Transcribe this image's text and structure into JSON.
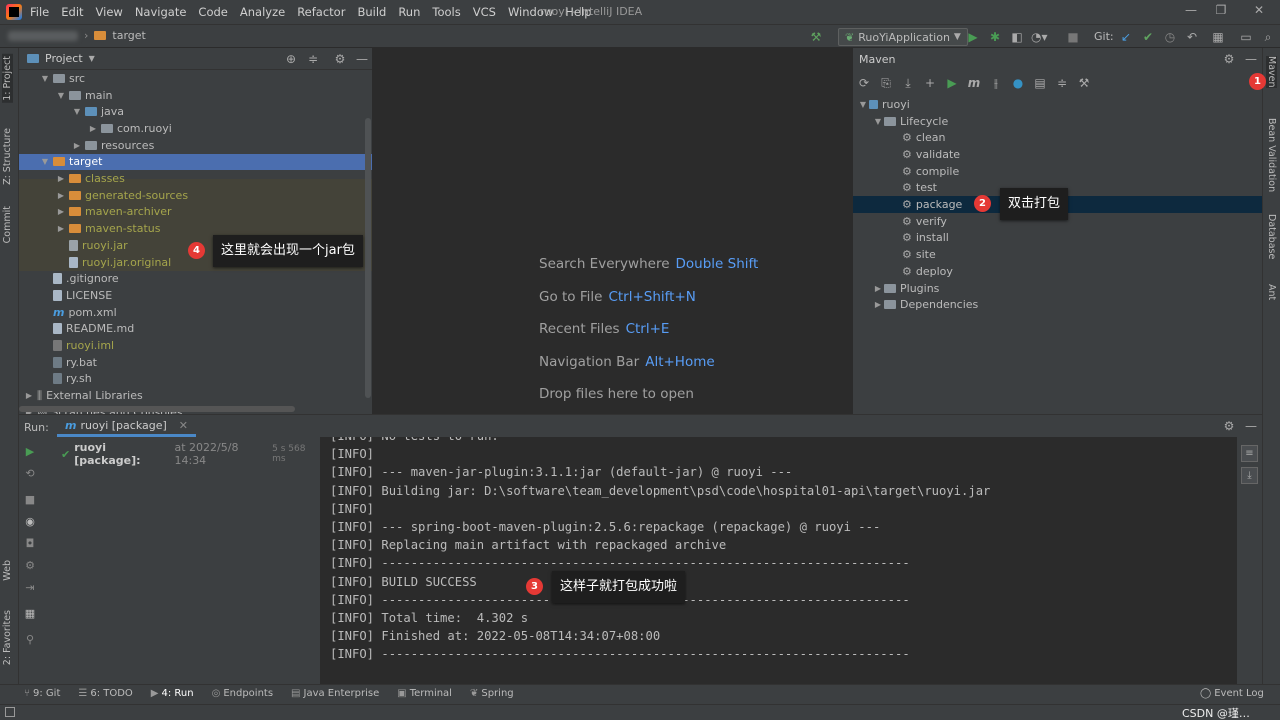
{
  "menubar": {
    "items": [
      "File",
      "Edit",
      "View",
      "Navigate",
      "Code",
      "Analyze",
      "Refactor",
      "Build",
      "Run",
      "Tools",
      "VCS",
      "Window",
      "Help"
    ],
    "window_title": "ruoyi - IntelliJ IDEA"
  },
  "navbar": {
    "breadcrumb": "target",
    "run_config": "RuoYiApplication",
    "git_label": "Git:"
  },
  "left_stripe": {
    "tabs": [
      "1: Project",
      "Z: Structure",
      "Commit",
      "Web",
      "2: Favorites"
    ]
  },
  "right_stripe": {
    "tabs": [
      "Maven",
      "Bean Validation",
      "Database",
      "Ant"
    ]
  },
  "project": {
    "title": "Project",
    "tree": [
      {
        "label": "src",
        "indent": 1,
        "arrow": "▼",
        "icon": "folder"
      },
      {
        "label": "main",
        "indent": 2,
        "arrow": "▼",
        "icon": "folder"
      },
      {
        "label": "java",
        "indent": 3,
        "arrow": "▼",
        "icon": "folder-blue"
      },
      {
        "label": "com.ruoyi",
        "indent": 4,
        "arrow": "▶",
        "icon": "package"
      },
      {
        "label": "resources",
        "indent": 3,
        "arrow": "▶",
        "icon": "folder-res"
      },
      {
        "label": "target",
        "indent": 1,
        "arrow": "▼",
        "icon": "folder-orange",
        "selected": true
      },
      {
        "label": "classes",
        "indent": 2,
        "arrow": "▶",
        "icon": "folder-orange",
        "olive": true
      },
      {
        "label": "generated-sources",
        "indent": 2,
        "arrow": "▶",
        "icon": "folder-orange",
        "olive": true
      },
      {
        "label": "maven-archiver",
        "indent": 2,
        "arrow": "▶",
        "icon": "folder-orange",
        "olive": true
      },
      {
        "label": "maven-status",
        "indent": 2,
        "arrow": "▶",
        "icon": "folder-orange",
        "olive": true
      },
      {
        "label": "ruoyi.jar",
        "indent": 2,
        "arrow": "",
        "icon": "jar",
        "olive": true
      },
      {
        "label": "ruoyi.jar.original",
        "indent": 2,
        "arrow": "",
        "icon": "file",
        "olive": true
      },
      {
        "label": ".gitignore",
        "indent": 1,
        "arrow": "",
        "icon": "file"
      },
      {
        "label": "LICENSE",
        "indent": 1,
        "arrow": "",
        "icon": "file"
      },
      {
        "label": "pom.xml",
        "indent": 1,
        "arrow": "",
        "icon": "maven"
      },
      {
        "label": "README.md",
        "indent": 1,
        "arrow": "",
        "icon": "file"
      },
      {
        "label": "ruoyi.iml",
        "indent": 1,
        "arrow": "",
        "icon": "iml",
        "olive": true
      },
      {
        "label": "ry.bat",
        "indent": 1,
        "arrow": "",
        "icon": "bat"
      },
      {
        "label": "ry.sh",
        "indent": 1,
        "arrow": "",
        "icon": "bat"
      },
      {
        "label": "External Libraries",
        "indent": 0,
        "arrow": "▶",
        "icon": "libs"
      },
      {
        "label": "Scratches and Consoles",
        "indent": 0,
        "arrow": "▶",
        "icon": "scratch"
      }
    ]
  },
  "editor": {
    "hints": [
      {
        "text": "Search Everywhere",
        "key": "Double Shift"
      },
      {
        "text": "Go to File",
        "key": "Ctrl+Shift+N"
      },
      {
        "text": "Recent Files",
        "key": "Ctrl+E"
      },
      {
        "text": "Navigation Bar",
        "key": "Alt+Home"
      },
      {
        "text": "Drop files here to open",
        "key": ""
      }
    ]
  },
  "maven": {
    "title": "Maven",
    "tree": [
      {
        "label": "ruoyi",
        "indent": 0,
        "arrow": "▼",
        "icon": "maven-root"
      },
      {
        "label": "Lifecycle",
        "indent": 1,
        "arrow": "▼",
        "icon": "folder-gear"
      },
      {
        "label": "clean",
        "indent": 3,
        "icon": "gear"
      },
      {
        "label": "validate",
        "indent": 3,
        "icon": "gear"
      },
      {
        "label": "compile",
        "indent": 3,
        "icon": "gear"
      },
      {
        "label": "test",
        "indent": 3,
        "icon": "gear"
      },
      {
        "label": "package",
        "indent": 3,
        "icon": "gear",
        "selected": true
      },
      {
        "label": "verify",
        "indent": 3,
        "icon": "gear"
      },
      {
        "label": "install",
        "indent": 3,
        "icon": "gear"
      },
      {
        "label": "site",
        "indent": 3,
        "icon": "gear"
      },
      {
        "label": "deploy",
        "indent": 3,
        "icon": "gear"
      },
      {
        "label": "Plugins",
        "indent": 1,
        "arrow": "▶",
        "icon": "folder-gear"
      },
      {
        "label": "Dependencies",
        "indent": 1,
        "arrow": "▶",
        "icon": "folder-gear"
      }
    ]
  },
  "callouts": {
    "c1": {
      "num": "1"
    },
    "c2": {
      "num": "2",
      "text": "双击打包"
    },
    "c3": {
      "num": "3",
      "text": "这样子就打包成功啦"
    },
    "c4": {
      "num": "4",
      "text": "这里就会出现一个jar包"
    }
  },
  "run": {
    "label": "Run:",
    "tab": "ruoyi [package]",
    "tree_item": "ruoyi [package]:",
    "tree_time": "at 2022/5/8 14:34",
    "tree_duration": "5 s 568 ms",
    "console": [
      "[INFO] No tests to run.",
      "[INFO]",
      "[INFO] --- maven-jar-plugin:3.1.1:jar (default-jar) @ ruoyi ---",
      "[INFO] Building jar: D:\\software\\team_development\\psd\\code\\hospital01-api\\target\\ruoyi.jar",
      "[INFO]",
      "[INFO] --- spring-boot-maven-plugin:2.5.6:repackage (repackage) @ ruoyi ---",
      "[INFO] Replacing main artifact with repackaged archive",
      "[INFO] ------------------------------------------------------------------------",
      "[INFO] BUILD SUCCESS",
      "[INFO] ------------------------------------------------------------------------",
      "[INFO] Total time:  4.302 s",
      "[INFO] Finished at: 2022-05-08T14:34:07+08:00",
      "[INFO] ------------------------------------------------------------------------"
    ]
  },
  "bottombar": {
    "tabs": [
      {
        "label": "9: Git",
        "icon": "⑂"
      },
      {
        "label": "6: TODO",
        "icon": "☰"
      },
      {
        "label": "4: Run",
        "icon": "▶"
      },
      {
        "label": "Endpoints",
        "icon": "◎"
      },
      {
        "label": "Java Enterprise",
        "icon": "▤"
      },
      {
        "label": "Terminal",
        "icon": "▣"
      },
      {
        "label": "Spring",
        "icon": "❦"
      }
    ],
    "event_log": "Event Log"
  },
  "statusbar": {
    "right_text": "CSDN @瑾…  master"
  },
  "colors": {
    "accent": "#4b6eaf",
    "run_green": "#499c54",
    "badge_red": "#e53935"
  }
}
